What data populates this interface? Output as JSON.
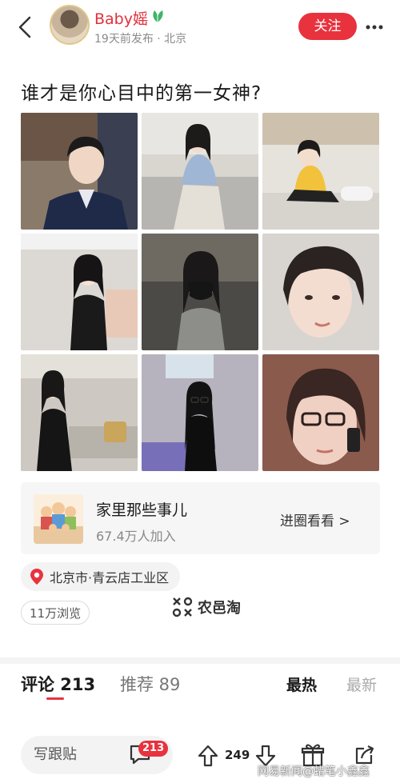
{
  "header": {
    "username": "Baby媱",
    "meta": "19天前发布 · 北京",
    "follow_label": "关注"
  },
  "post": {
    "title": "谁才是你心目中的第一女神?"
  },
  "circle": {
    "name": "家里那些事儿",
    "members": "67.4万人加入",
    "enter_label": "进圈看看 >"
  },
  "location": "北京市·青云店工业区",
  "views": "11万浏览",
  "watermark_brand": "农邑淘",
  "tabs": {
    "comment": "评论 213",
    "recommend": "推荐 89",
    "sort_hot": "最热",
    "sort_new": "最新"
  },
  "bottom": {
    "reply_placeholder": "写跟贴",
    "comment_badge": "213",
    "like_count": "249"
  },
  "footer_watermark": "网易新闻@蜡笔小鑫鑫",
  "colors": {
    "accent": "#e8323e",
    "username": "#e0303c"
  }
}
